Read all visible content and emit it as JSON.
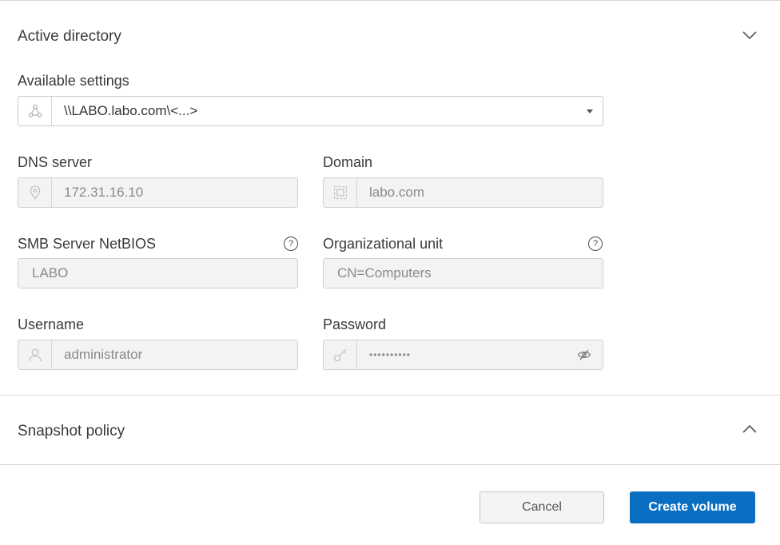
{
  "active_directory": {
    "title": "Active directory",
    "expanded": true,
    "available_settings": {
      "label": "Available settings",
      "value": "\\\\LABO.labo.com\\<...>",
      "icon": "network-icon"
    },
    "dns_server": {
      "label": "DNS server",
      "value": "172.31.16.10",
      "icon": "location-pin-icon"
    },
    "domain": {
      "label": "Domain",
      "value": "labo.com",
      "icon": "domain-icon"
    },
    "smb_netbios": {
      "label": "SMB Server NetBIOS",
      "value": "LABO",
      "help": "?"
    },
    "org_unit": {
      "label": "Organizational unit",
      "value": "CN=Computers",
      "help": "?"
    },
    "username": {
      "label": "Username",
      "value": "administrator",
      "icon": "user-icon"
    },
    "password": {
      "label": "Password",
      "value": "••••••••••",
      "icon": "key-icon",
      "toggle_icon": "eye-off-icon"
    }
  },
  "snapshot_policy": {
    "title": "Snapshot policy",
    "expanded": false
  },
  "footer": {
    "cancel_label": "Cancel",
    "create_label": "Create volume"
  },
  "colors": {
    "primary": "#0a6fc2",
    "field_bg": "#f3f3f3",
    "border": "#d0d0d0"
  }
}
